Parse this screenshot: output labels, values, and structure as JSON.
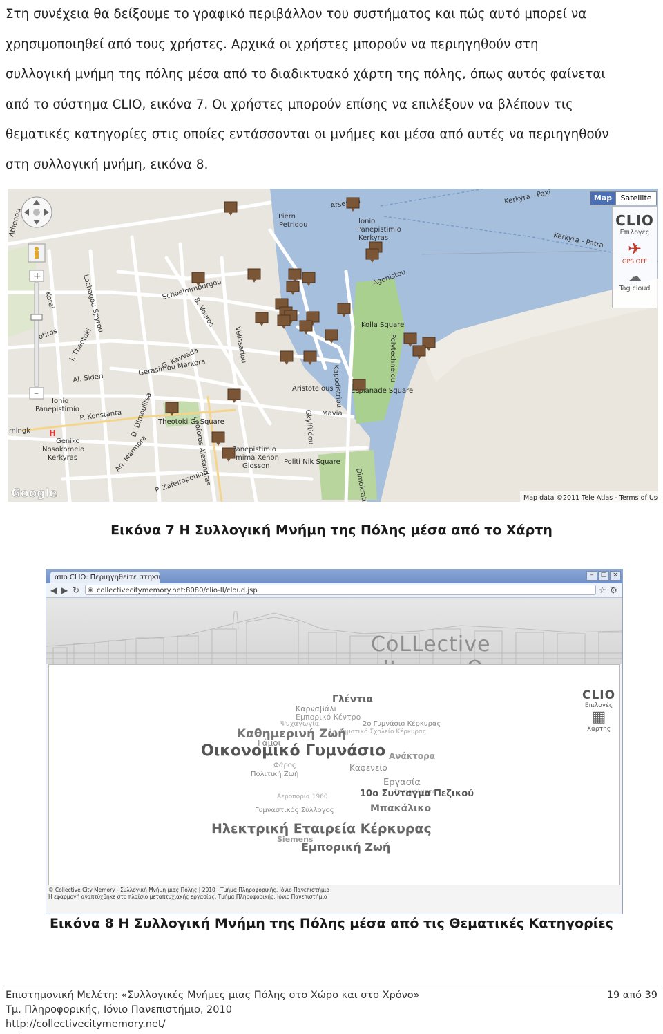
{
  "paragraph": [
    "Στη συνέχεια θα δείξουμε το γραφικό περιβάλλον του συστήματος και πώς αυτό μπορεί να",
    "χρησιμοποιηθεί από τους χρήστες. Αρχικά οι χρήστες μπορούν να περιηγηθούν στη",
    "συλλογική μνήμη της πόλης μέσα από το διαδικτυακό χάρτη της πόλης, όπως αυτός φαίνεται",
    "από το σύστημα CLIO, εικόνα 7. Οι χρήστες μπορούν επίσης να επιλέξουν να βλέπουν τις",
    "θεματικές κατηγορίες στις οποίες εντάσσονται οι μνήμες και μέσα από αυτές να περιηγηθούν",
    "στη συλλογική μνήμη, εικόνα 8."
  ],
  "figure7": {
    "caption": "Εικόνα 7 Η Συλλογική Μνήμη της Πόλης μέσα από το Χάρτη",
    "map_type_buttons": [
      "Map",
      "Satellite"
    ],
    "clio_panel": {
      "logo": "CLIO",
      "options_label": "Επιλογές",
      "gps_label": "GPS OFF",
      "tag_cloud_label": "Tag cloud"
    },
    "attribution": "Map data ©2011 Tele Atlas - Terms of Use",
    "google_logo": "Google",
    "hospital_letter": "H",
    "street_labels": {
      "arseniou": "Arseniou",
      "piern": "Piern",
      "petridou": "Petridou",
      "ionio": "Ionio",
      "panepistimio": "Panepistimio",
      "kerkyras": "Kerkyras",
      "kerkyra_paxi": "Kerkyra - Paxi",
      "kerkyra_patra": "Kerkyra - Patra",
      "agonistou": "Agonistou",
      "polytechneiou": "Polytechneiou",
      "kolla_square": "Kolla Square",
      "schoelmmburgou": "Schoelmmburgou",
      "velissariou": "Velissariou",
      "al_sideri": "Al. Sideri",
      "ionio2": "Ionio",
      "panepistimio2": "Panepistimio",
      "konstanta": "P. Konstanta",
      "gerasimou_markora": "Gerasimou Markora",
      "kavvada": "G. Kavvada",
      "theotoki_square": "Theotoki G. Square",
      "geniko": "Geniko",
      "nosokomeio": "Nosokomeio",
      "kerkyras2": "Kerkyras",
      "mingk": "mingk",
      "leoforos": "Leoforos Alexandras",
      "zafeiropoulou": "P. Zafeiropoulou",
      "marmora": "An. Marmora",
      "dimoulitsa": "D. Dimoulitsa",
      "aristotelous": "Aristotelous",
      "kapodistriou": "Kapodistriou",
      "giykitiou": "Gkylftidou",
      "maria": "Mavia",
      "politi_nik": "Politi Nik Square",
      "panepistimio3": "Panepistimio",
      "mima_xenon": "mima Xenon",
      "glosson": "Glosson",
      "dimokratias": "Dimokratias",
      "esplanade": "Esplanade Square",
      "theotoki_l": "I. Theotoki",
      "korai": "Korai",
      "lochagou": "Lochagou Spyrou",
      "vouros": "B. Vouros",
      "athenou": "Athenou",
      "sotiros": "Sotiros"
    }
  },
  "figure8": {
    "caption": "Εικόνα 8 Η Συλλογική Μνήμη της Πόλης μέσα από τις Θεματικές Κατηγορίες",
    "tab_title": "απο CLIO: Περιηγηθείτε στη συ...",
    "url": "collectivecitymemory.net:8080/clio-II/cloud.jsp",
    "banner_title": "CoLLective cItymemOry",
    "clio_logo": "CLIO",
    "clio_options": "Επιλογές",
    "clio_map_label": "Χάρτης",
    "footer_lines": [
      "© Collective City Memory - Συλλογική Μνήμη μιας Πόλης | 2010 | Τμήμα Πληροφορικής, Ιόνιο Πανεπιστήμιο",
      "Η εφαρμογή αναπτύχθηκε στο πλαίσιο μεταπτυχιακής εργασίας. Τμήμα Πληροφορικής, Ιόνιο Πανεπιστήμιο"
    ],
    "cloud_words": [
      {
        "text": "Γλέντια"
      },
      {
        "text": "Καρναβάλι"
      },
      {
        "text": "Εμπορικό Κέντρο"
      },
      {
        "text": "Ψυχαγωγία"
      },
      {
        "text": "2ο Γυμνάσιο Κέρκυρας"
      },
      {
        "text": "1ο Δημοτικό Σχολείο Κέρκυρας"
      },
      {
        "text": "Καθημερινή Ζωή"
      },
      {
        "text": "Γάμοι"
      },
      {
        "text": "Οικονομικό Γυμνάσιο"
      },
      {
        "text": "Ανάκτορα"
      },
      {
        "text": "Φάρος"
      },
      {
        "text": "Καφενείο"
      },
      {
        "text": "Πολιτική Ζωή"
      },
      {
        "text": "Εργασία"
      },
      {
        "text": "Επαγγέλματα"
      },
      {
        "text": "Αεροπορία 1960"
      },
      {
        "text": "10ο Συνταγμα Πεζικού"
      },
      {
        "text": "Γυμναστικός Σύλλογος"
      },
      {
        "text": "Μπακάλικο"
      },
      {
        "text": "Ηλεκτρική Εταιρεία Κέρκυρας"
      },
      {
        "text": "Siemens"
      },
      {
        "text": "Εμπορική Ζωή"
      }
    ]
  },
  "footer": {
    "study_title": "Επιστημονική Μελέτη: «Συλλογικές Μνήμες μιας Πόλης στο Χώρο και στο Χρόνο»",
    "department": "Τμ. Πληροφορικής, Ιόνιο Πανεπιστήμιο, 2010",
    "url": "http://collectivecitymemory.net/",
    "page_number": "19 από 39"
  },
  "colors": {
    "sea": "#a6bfdd",
    "land": "#e9e6df",
    "park": "#a9d08e",
    "road": "#ffffff",
    "marker": "#7a5637",
    "accent": "#4b6fb5"
  }
}
